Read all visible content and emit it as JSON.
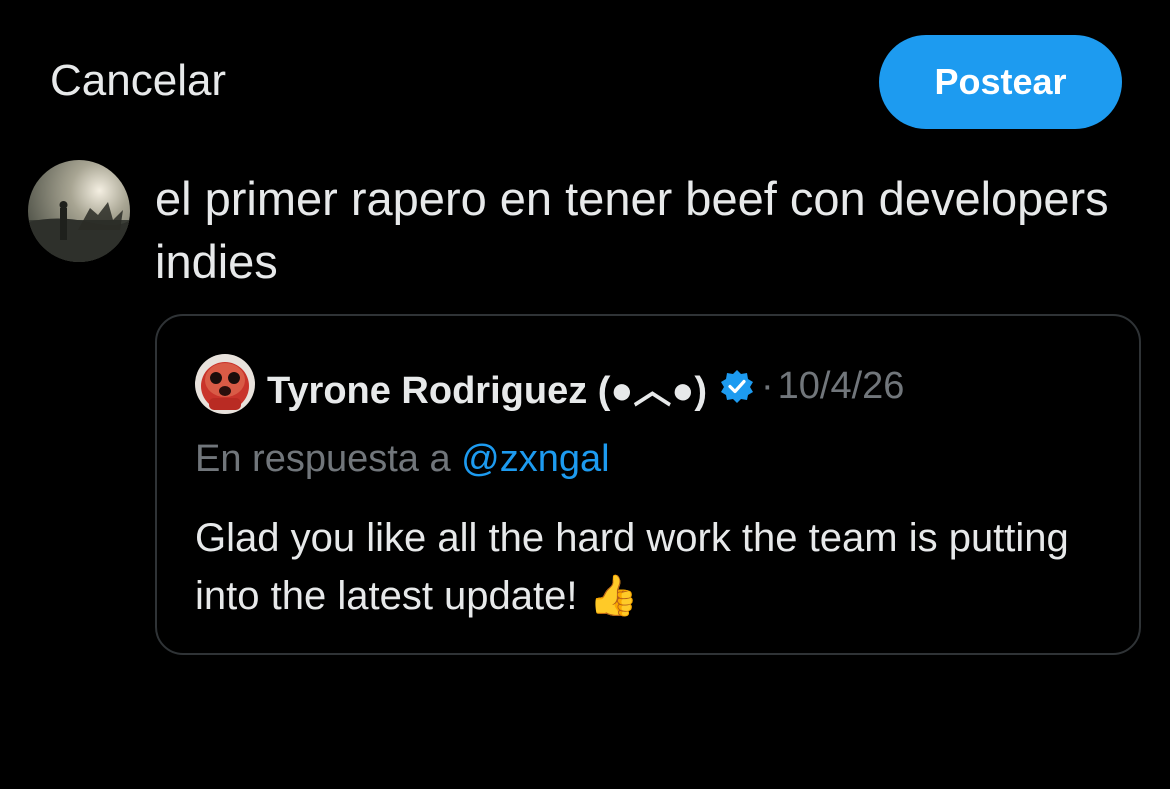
{
  "header": {
    "cancel_label": "Cancelar",
    "post_label": "Postear"
  },
  "compose": {
    "text": "el primer rapero en tener beef con developers indies"
  },
  "quoted_post": {
    "display_name": "Tyrone Rodriguez (●︿●)",
    "verified": true,
    "separator": "·",
    "date": "10/4/26",
    "reply_prefix": "En respuesta a ",
    "reply_handle": "@zxngal",
    "body": "Glad you like all the hard work the team is putting into the latest update! 👍"
  },
  "icons": {
    "user_avatar": "avatar-photo-icon",
    "quoted_avatar": "red-creature-avatar-icon",
    "verified_badge": "verified-badge-icon"
  },
  "colors": {
    "background": "#000000",
    "accent": "#1d9bf0",
    "text_primary": "#e7e9ea",
    "text_secondary": "#71767b",
    "border": "#2f3336"
  }
}
